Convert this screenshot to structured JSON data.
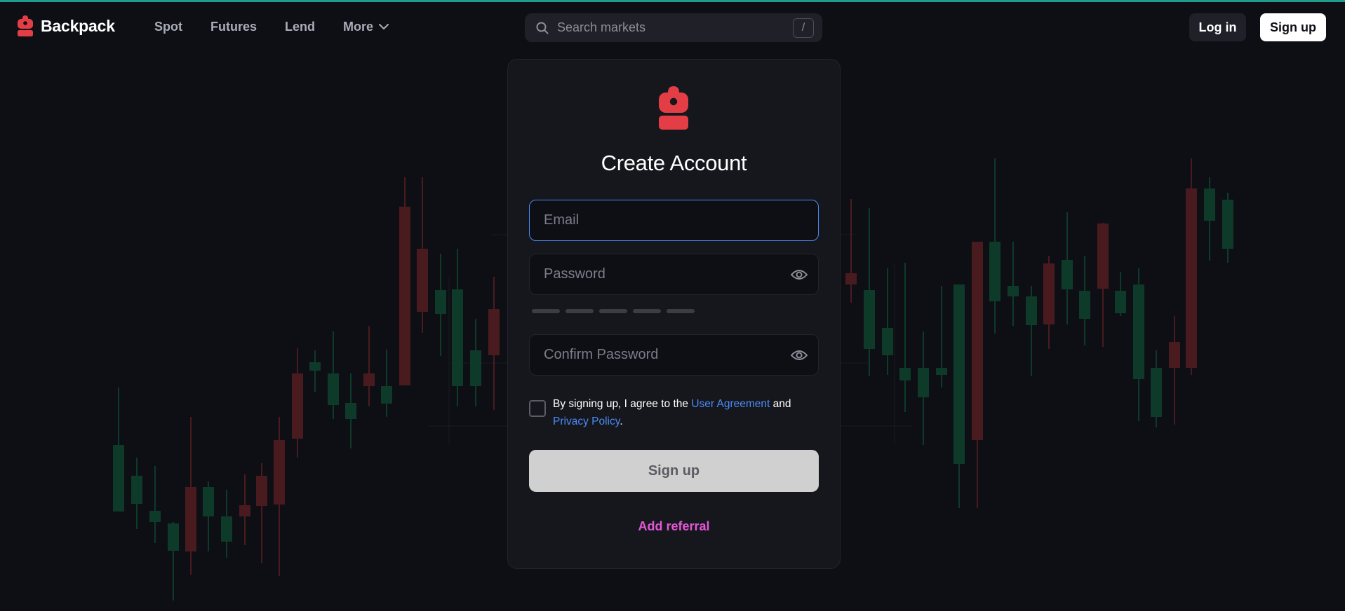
{
  "brand": {
    "name": "Backpack",
    "icon": "backpack-icon",
    "color": "#e33d45"
  },
  "nav": {
    "links": [
      {
        "label": "Spot"
      },
      {
        "label": "Futures"
      },
      {
        "label": "Lend"
      },
      {
        "label": "More",
        "icon": "chevron-down-icon"
      }
    ]
  },
  "search": {
    "placeholder": "Search markets",
    "shortcut": "/",
    "icon": "search-icon"
  },
  "header_actions": {
    "login_label": "Log in",
    "signup_label": "Sign up"
  },
  "form": {
    "title": "Create Account",
    "email_placeholder": "Email",
    "password_placeholder": "Password",
    "confirm_placeholder": "Confirm Password",
    "strength_segments": 5,
    "agreement": {
      "prefix": "By signing up, I agree to the",
      "user_agreement": "User Agreement",
      "and": "and",
      "privacy_policy": "Privacy Policy",
      "suffix": "."
    },
    "submit_label": "Sign up",
    "referral_label": "Add referral"
  },
  "colors": {
    "background": "#0e0f14",
    "card": "#16171d",
    "link": "#4a8bf5",
    "referral": "#e357d6",
    "accent_bar": "#1f9c8e",
    "candle_up": "#0e3a2a",
    "candle_down": "#4a1b1e"
  }
}
